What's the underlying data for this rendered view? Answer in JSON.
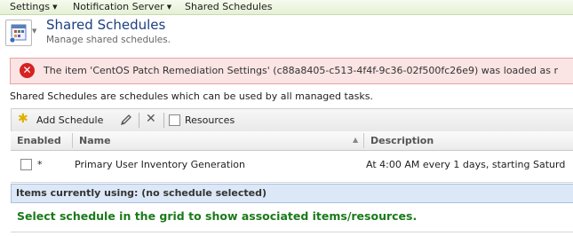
{
  "topnav": {
    "items": [
      {
        "label": "Settings"
      },
      {
        "label": "Notification Server"
      },
      {
        "label": "Shared Schedules"
      }
    ]
  },
  "header": {
    "title": "Shared Schedules",
    "subtitle": "Manage shared schedules."
  },
  "error": {
    "message": "The item 'CentOS Patch Remediation Settings' (c88a8405-c513-4f4f-9c36-02f500fc26e9) was loaded as r",
    "icon": "error-x-icon",
    "color": "#d62222"
  },
  "info": {
    "text": "Shared Schedules are schedules which can be used by all managed tasks."
  },
  "toolbar": {
    "add_label": "Add Schedule",
    "resources_label": "Resources",
    "resources_checked": false
  },
  "grid": {
    "columns": [
      {
        "label": "Enabled"
      },
      {
        "label": "Name"
      },
      {
        "label": "Description"
      }
    ],
    "rows": [
      {
        "enabled": false,
        "marker": "*",
        "name": "Primary User Inventory Generation",
        "description": "At 4:00 AM every 1 days, starting Saturd"
      }
    ]
  },
  "items_using": {
    "label": "Items currently using:  (no schedule selected)",
    "message": "Select schedule in the grid to show associated items/resources.",
    "message_color": "#1a7a1a"
  }
}
